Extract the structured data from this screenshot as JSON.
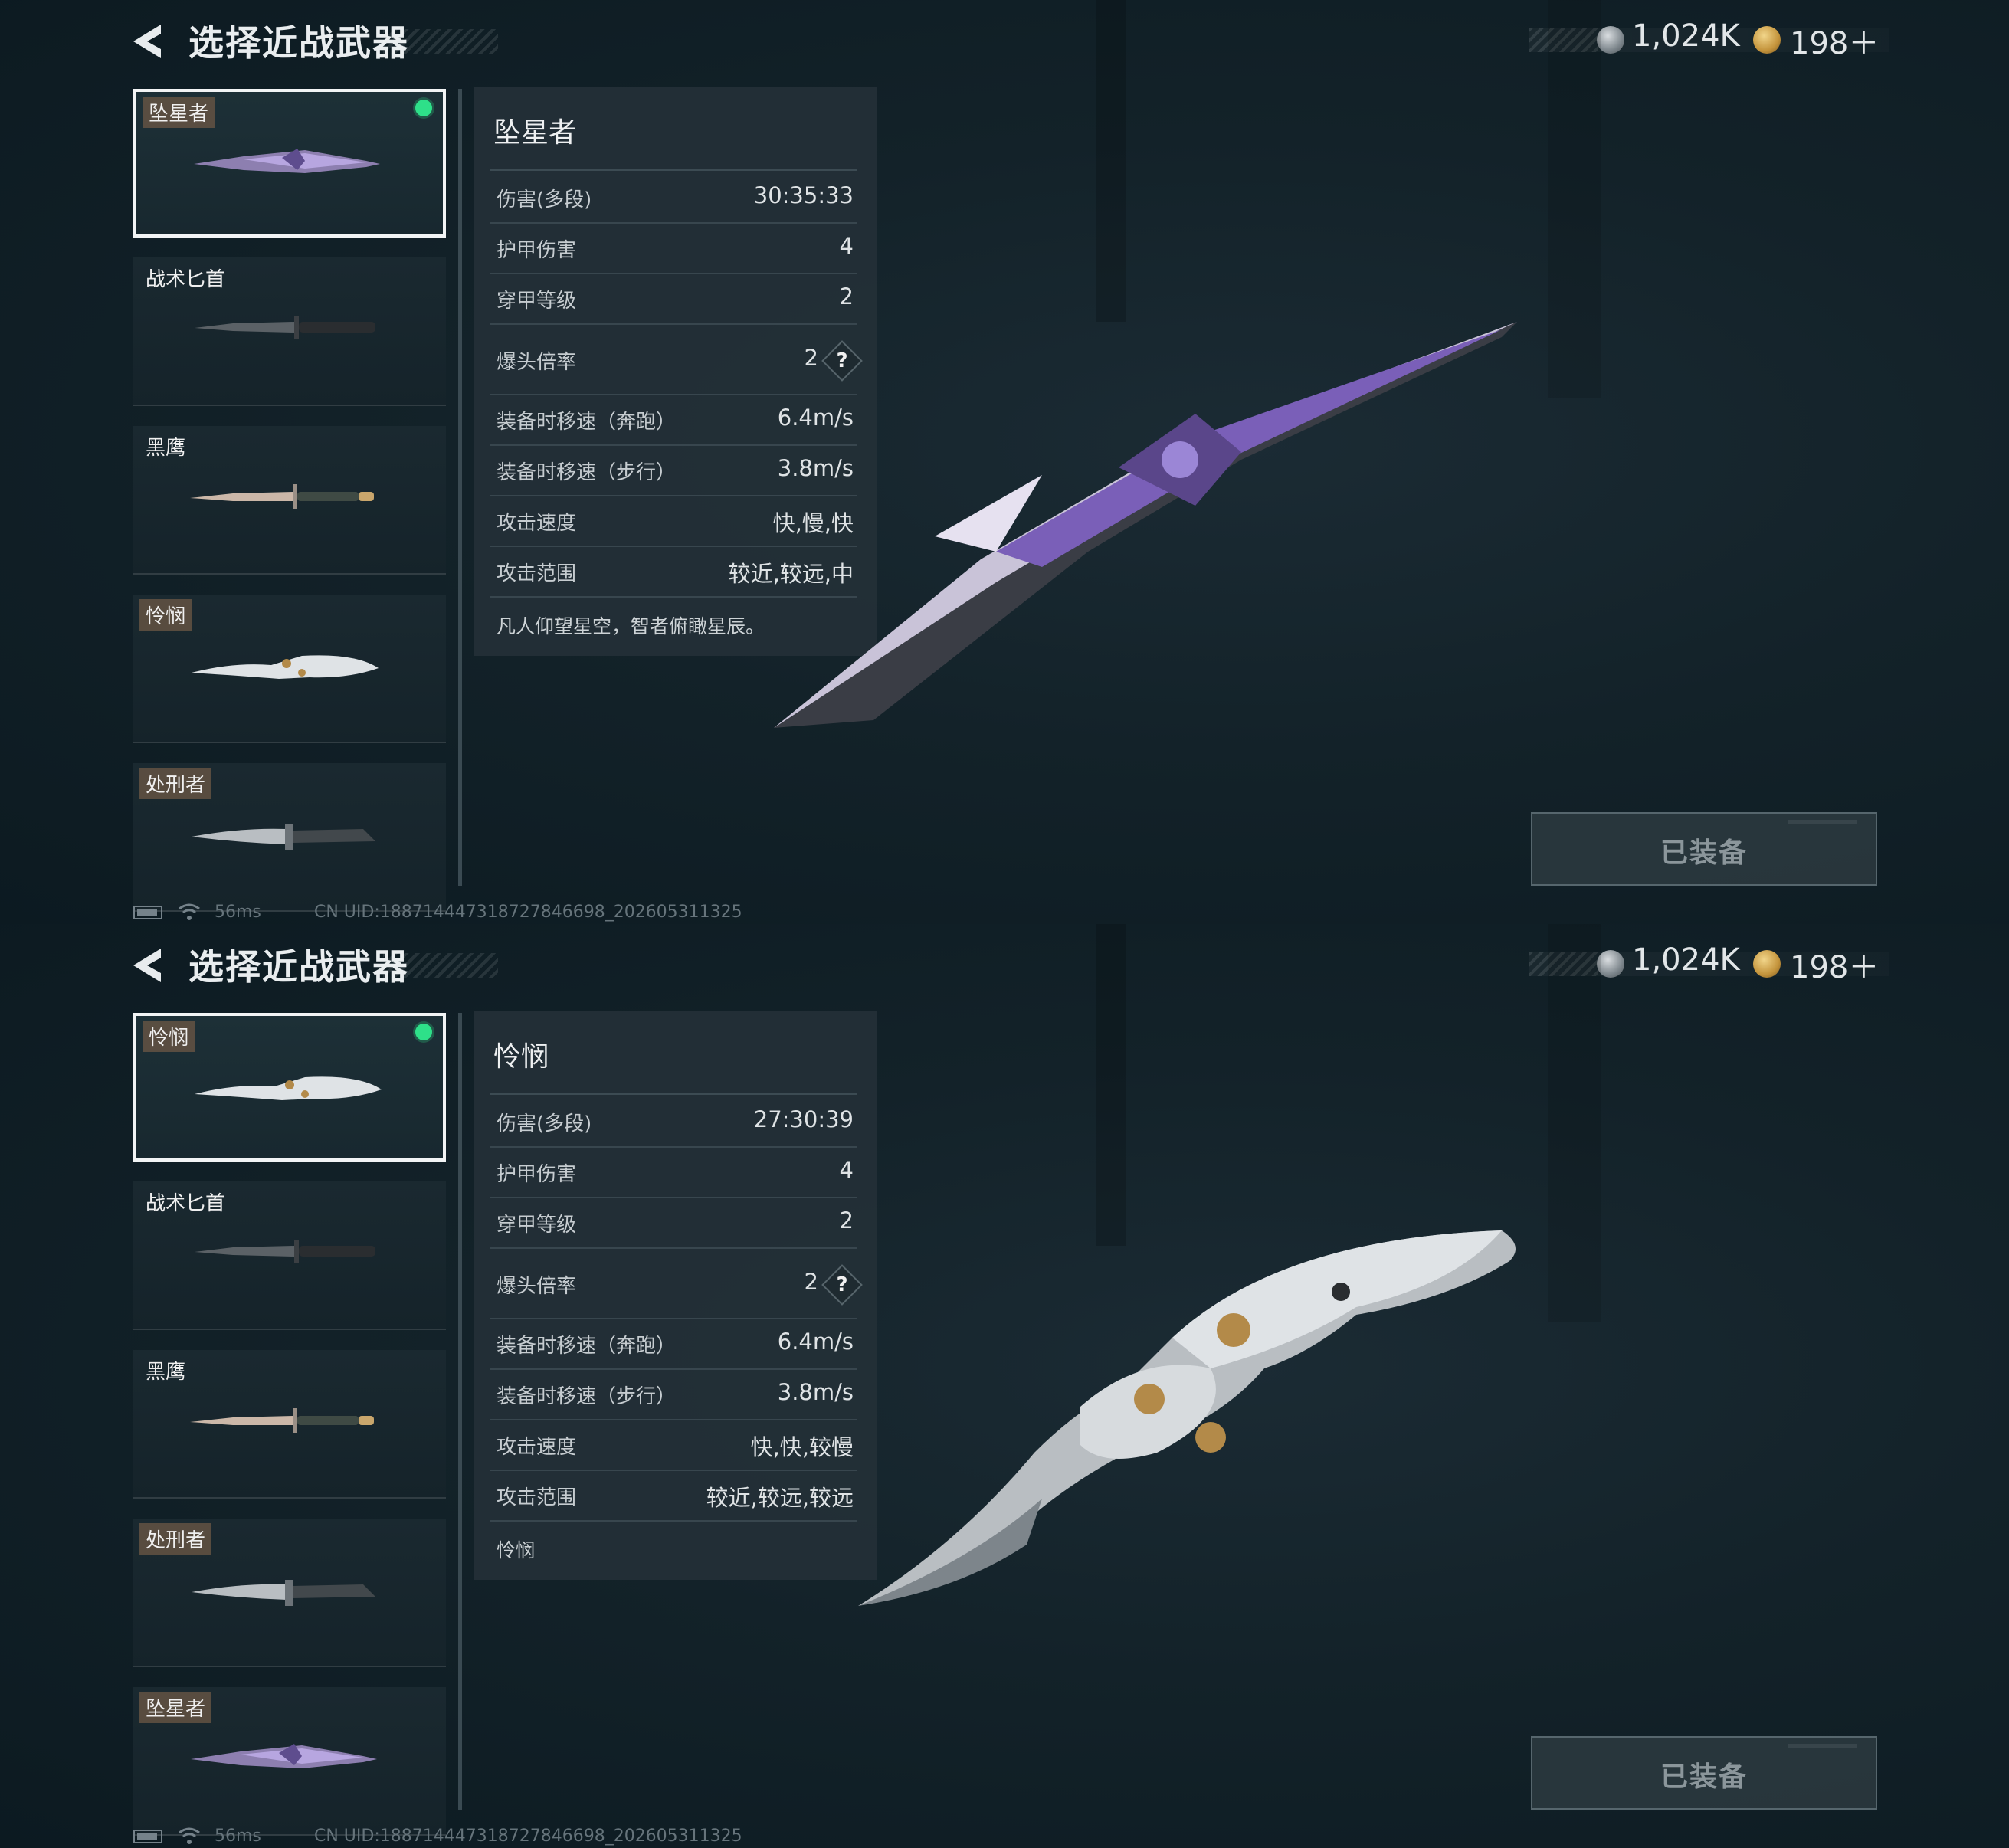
{
  "panels": [
    {
      "header": {
        "title": "选择近战武器"
      },
      "currency": {
        "silver": "1,024K",
        "gold": "198＋"
      },
      "list": [
        {
          "name": "坠星者",
          "selected": true,
          "equipped": true
        },
        {
          "name": "战术匕首"
        },
        {
          "name": "黑鹰"
        },
        {
          "name": "怜悯"
        },
        {
          "name": "处刑者"
        }
      ],
      "stats": {
        "name": "坠星者",
        "rows": [
          {
            "label": "伤害(多段)",
            "value": "30:35:33"
          },
          {
            "label": "护甲伤害",
            "value": "4"
          },
          {
            "label": "穿甲等级",
            "value": "2"
          },
          {
            "label": "爆头倍率",
            "value": "2"
          },
          {
            "label": "装备时移速（奔跑）",
            "value": "6.4m/s"
          },
          {
            "label": "装备时移速（步行）",
            "value": "3.8m/s"
          },
          {
            "label": "攻击速度",
            "value": "快,慢,快"
          },
          {
            "label": "攻击范围",
            "value": "较近,较远,中"
          }
        ],
        "question_mark": "?",
        "description": "凡人仰望星空，智者俯瞰星辰。"
      },
      "equip_button": "已装备",
      "status": {
        "ping": "56ms",
        "uid": "CN UID:1887144473187278466​98_202605311325"
      }
    },
    {
      "header": {
        "title": "选择近战武器"
      },
      "currency": {
        "silver": "1,024K",
        "gold": "198＋"
      },
      "list": [
        {
          "name": "怜悯",
          "selected": true,
          "equipped": true
        },
        {
          "name": "战术匕首"
        },
        {
          "name": "黑鹰"
        },
        {
          "name": "处刑者"
        },
        {
          "name": "坠星者"
        }
      ],
      "stats": {
        "name": "怜悯",
        "rows": [
          {
            "label": "伤害(多段)",
            "value": "27:30:39"
          },
          {
            "label": "护甲伤害",
            "value": "4"
          },
          {
            "label": "穿甲等级",
            "value": "2"
          },
          {
            "label": "爆头倍率",
            "value": "2"
          },
          {
            "label": "装备时移速（奔跑）",
            "value": "6.4m/s"
          },
          {
            "label": "装备时移速（步行）",
            "value": "3.8m/s"
          },
          {
            "label": "攻击速度",
            "value": "快,快,较慢"
          },
          {
            "label": "攻击范围",
            "value": "较近,较远,较远"
          }
        ],
        "question_mark": "?",
        "description": "怜悯"
      },
      "equip_button": "已装备",
      "status": {
        "ping": "56ms",
        "uid": "CN UID:188714447318727846698_202605311325"
      }
    }
  ],
  "colors": {
    "equipped_dot": "#2ee089",
    "selected_border": "#f2f4f5",
    "background": "#132229"
  }
}
